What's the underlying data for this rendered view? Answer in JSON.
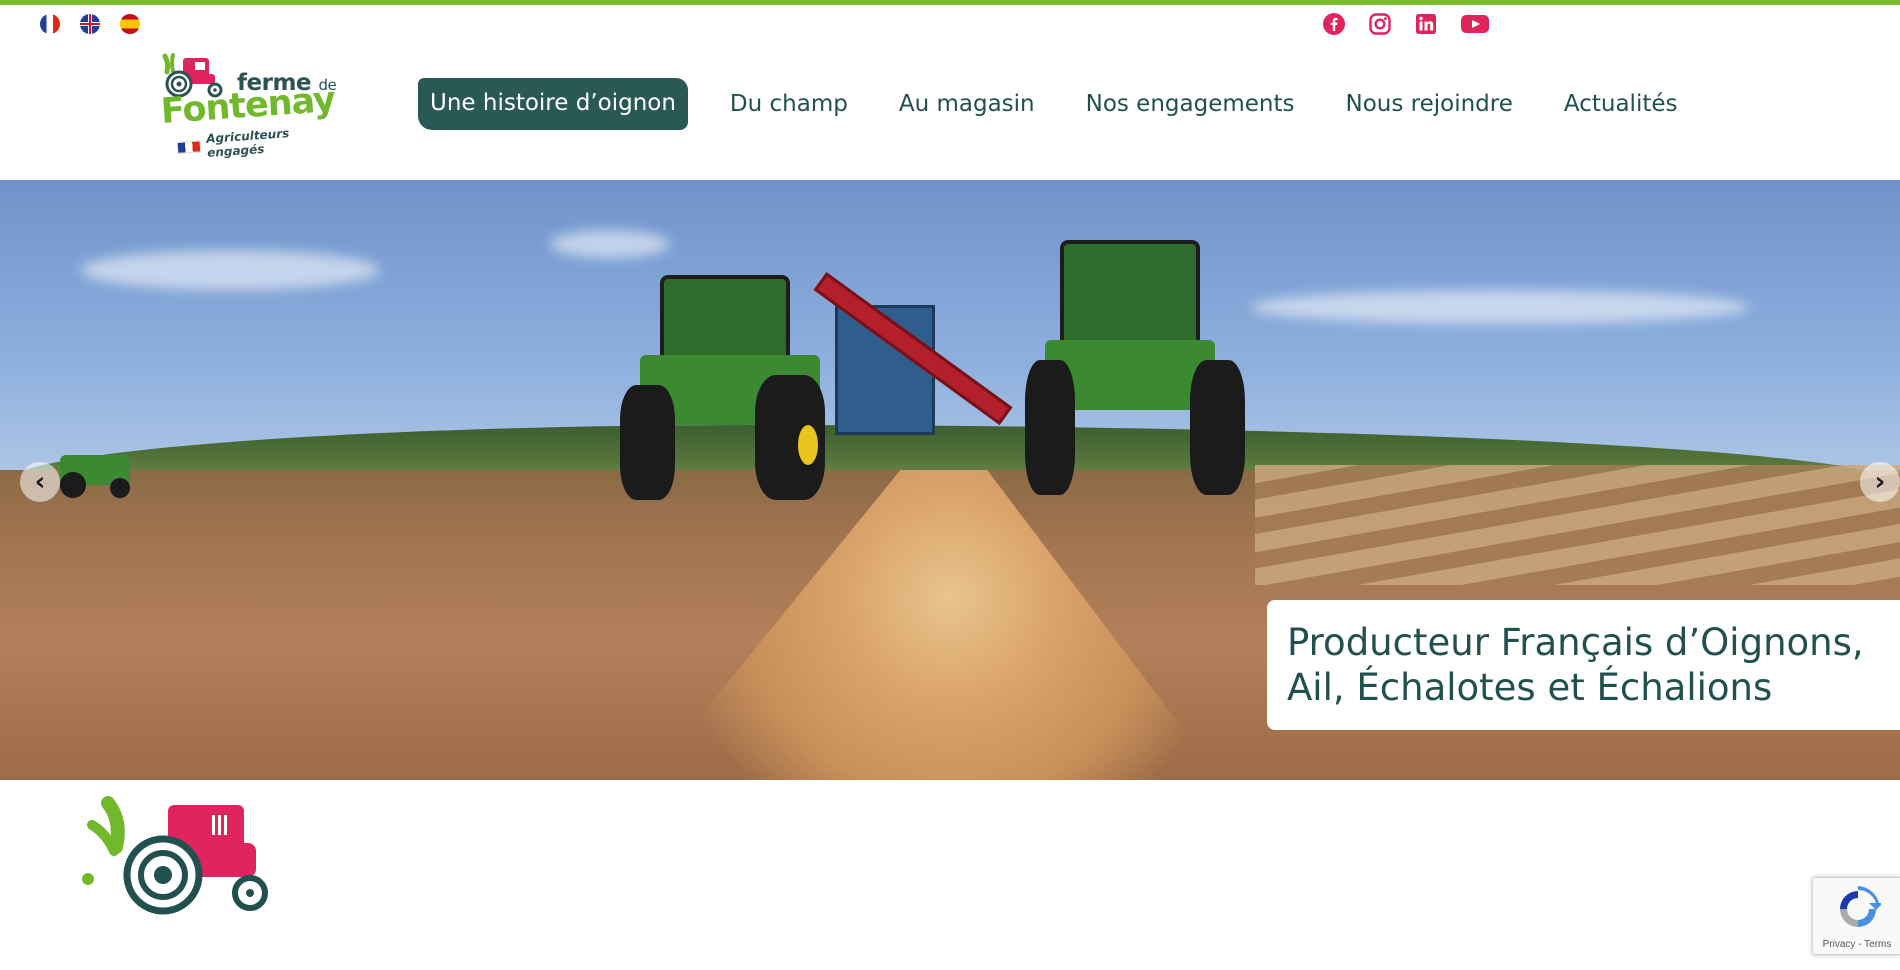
{
  "languages": [
    {
      "code": "fr",
      "icon": "flag-fr-icon"
    },
    {
      "code": "en",
      "icon": "flag-uk-icon"
    },
    {
      "code": "es",
      "icon": "flag-es-icon"
    }
  ],
  "social": [
    {
      "name": "facebook",
      "icon": "facebook-icon",
      "color": "#e0245e"
    },
    {
      "name": "instagram",
      "icon": "instagram-icon",
      "color": "#e0245e"
    },
    {
      "name": "linkedin",
      "icon": "linkedin-icon",
      "color": "#e0245e"
    },
    {
      "name": "youtube",
      "icon": "youtube-icon",
      "color": "#e0245e"
    }
  ],
  "logo": {
    "ferme": "ferme",
    "de": "de",
    "fontenay": "Fontenay",
    "tagline": "Agriculteurs engagés"
  },
  "nav": {
    "items": [
      {
        "label": "Une histoire d’oignon",
        "active": true
      },
      {
        "label": "Du champ"
      },
      {
        "label": "Au magasin"
      },
      {
        "label": "Nos engagements"
      },
      {
        "label": "Nous rejoindre"
      },
      {
        "label": "Actualités"
      }
    ]
  },
  "hero": {
    "caption_line1": "Producteur Français d’Oignons,",
    "caption_line2": "Ail, Échalotes et Échalions",
    "prev_icon": "chevron-left-icon",
    "next_icon": "chevron-right-icon",
    "prev_glyph": "‹",
    "next_glyph": "›"
  },
  "recaptcha": {
    "links": "Privacy - Terms"
  },
  "colors": {
    "accent_green": "#7cbd2f",
    "dark_teal": "#22504e",
    "brand_pink": "#e0245e"
  }
}
